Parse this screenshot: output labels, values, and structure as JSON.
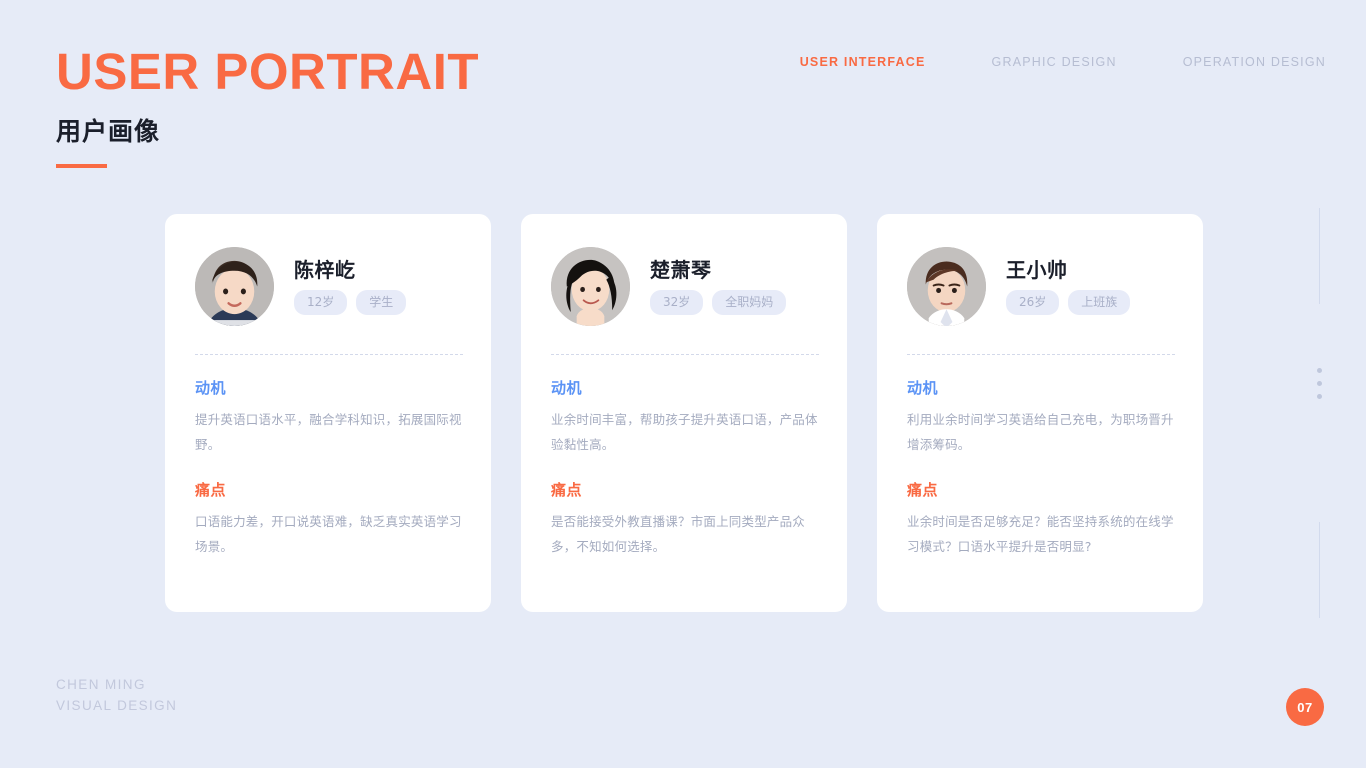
{
  "header": {
    "title_en": "USER PORTRAIT",
    "title_cn": "用户画像",
    "accent_color": "#f96a43"
  },
  "nav": {
    "items": [
      {
        "label": "USER INTERFACE",
        "active": true
      },
      {
        "label": "GRAPHIC DESIGN",
        "active": false
      },
      {
        "label": "OPERATION DESIGN",
        "active": false
      }
    ]
  },
  "cards": [
    {
      "avatar": "boy-avatar",
      "name": "陈梓屹",
      "tags": [
        "12岁",
        "学生"
      ],
      "motivation_label": "动机",
      "motivation_text": "提升英语口语水平，融合学科知识，拓展国际视野。",
      "painpoint_label": "痛点",
      "painpoint_text": "口语能力差，开口说英语难，缺乏真实英语学习场景。"
    },
    {
      "avatar": "woman-avatar",
      "name": "楚萧琴",
      "tags": [
        "32岁",
        "全职妈妈"
      ],
      "motivation_label": "动机",
      "motivation_text": "业余时间丰富，帮助孩子提升英语口语，产品体验黏性高。",
      "painpoint_label": "痛点",
      "painpoint_text": "是否能接受外教直播课？市面上同类型产品众多，不知如何选择。"
    },
    {
      "avatar": "man-avatar",
      "name": "王小帅",
      "tags": [
        "26岁",
        "上班族"
      ],
      "motivation_label": "动机",
      "motivation_text": "利用业余时间学习英语给自己充电，为职场晋升增添筹码。",
      "painpoint_label": "痛点",
      "painpoint_text": "业余时间是否足够充足？能否坚持系统的在线学习模式？口语水平提升是否明显?"
    }
  ],
  "footer": {
    "credit_line1": "CHEN MING",
    "credit_line2": "VISUAL DESIGN",
    "page_number": "07"
  },
  "theme": {
    "background": "#e6ebf7",
    "card_background": "#ffffff",
    "motivation_color": "#5b93f5",
    "painpoint_color": "#f96a43",
    "body_text_color": "#a4abbf",
    "tag_background": "#e7ebf8"
  }
}
